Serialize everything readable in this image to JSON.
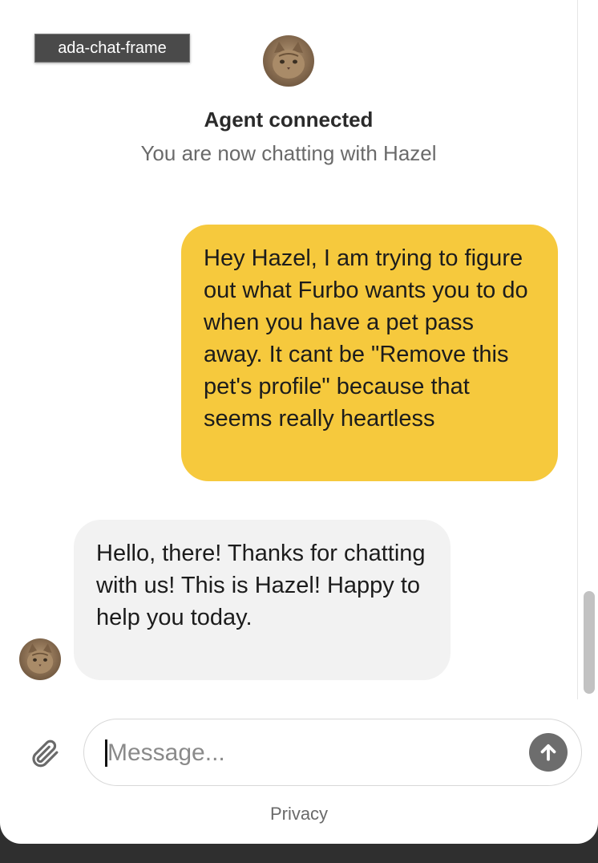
{
  "frame": {
    "label": "ada-chat-frame"
  },
  "status": {
    "title": "Agent connected",
    "subtitle": "You are now chatting with Hazel"
  },
  "messages": [
    {
      "sender": "user",
      "text": "Hey Hazel, I am trying to figure out what Furbo wants you to do when you have a pet pass away. It cant be \"Remove this pet's profile\" because that seems really heartless"
    },
    {
      "sender": "agent",
      "text": "Hello, there! Thanks for chatting with us! This is Hazel! Happy to help you today."
    }
  ],
  "composer": {
    "placeholder": "Message...",
    "value": ""
  },
  "footer": {
    "privacy_label": "Privacy"
  },
  "icons": {
    "attach": "paperclip-icon",
    "send": "arrow-up-icon",
    "avatar": "cat-avatar-icon"
  },
  "colors": {
    "user_bubble": "#f6c93d",
    "agent_bubble": "#f2f2f2",
    "send_button": "#6d6d6d"
  }
}
